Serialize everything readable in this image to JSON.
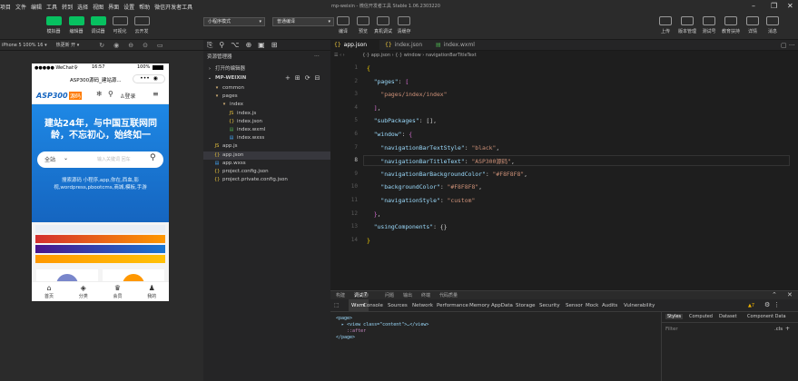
{
  "menu": [
    "项目",
    "文件",
    "编辑",
    "工具",
    "转到",
    "选择",
    "视图",
    "界面",
    "设置",
    "帮助",
    "微信开发者工具"
  ],
  "window_title": "mp-weixin - 微信开发者工具 Stable 1.06.2303220",
  "toolbar": {
    "left": [
      {
        "label": "模拟器",
        "icon": "phone-icon",
        "active": true
      },
      {
        "label": "编辑器",
        "icon": "code-icon",
        "active": true
      },
      {
        "label": "调试器",
        "icon": "debug-icon",
        "active": true
      },
      {
        "label": "可视化",
        "icon": "visual-icon",
        "active": false
      },
      {
        "label": "云开发",
        "icon": "cloud-icon",
        "active": false
      }
    ],
    "mode_select": "小程序模式",
    "compile_select": "普通编译",
    "center": [
      {
        "label": "编译",
        "icon": "refresh-icon"
      },
      {
        "label": "预览",
        "icon": "eye-icon"
      },
      {
        "label": "真机调试",
        "icon": "device-icon"
      },
      {
        "label": "清缓存",
        "icon": "clear-icon"
      }
    ],
    "right": [
      {
        "label": "上传",
        "icon": "upload-icon"
      },
      {
        "label": "版本管理",
        "icon": "branch-icon"
      },
      {
        "label": "测试号",
        "icon": "test-icon"
      },
      {
        "label": "教育扶持",
        "icon": "edu-icon"
      },
      {
        "label": "详情",
        "icon": "detail-icon"
      },
      {
        "label": "消息",
        "icon": "bell-icon"
      }
    ]
  },
  "simulator": {
    "device": "iPhone 5 100% 16 ▾",
    "network": "热更新 开 ▾",
    "status_left": "●●●●● WeChat令",
    "status_time": "16:57",
    "status_right": "100%",
    "nav_title": "ASP300源码_建站源...",
    "logo_text": "ASP300",
    "logo_badge": "源码",
    "login": "登录",
    "hero_title": "建站24年，与中国互联网同龄，不忘初心，始终如一",
    "search_scope": "全站",
    "search_placeholder": "输入关键词 回车",
    "hero_sub": "搜索源码 小程序,app,你在,西血,影视,wordpress,pbootcms,商城,模板,手游",
    "tabs": [
      {
        "label": "首页",
        "icon": "home-icon"
      },
      {
        "label": "分类",
        "icon": "layers-icon"
      },
      {
        "label": "会员",
        "icon": "crown-icon"
      },
      {
        "label": "我的",
        "icon": "user-icon"
      }
    ]
  },
  "explorer": {
    "title": "资源管理器",
    "open_editors": "打开的编辑器",
    "root": "MP-WEIXIN",
    "items": [
      {
        "name": "common",
        "type": "folder",
        "depth": 1
      },
      {
        "name": "pages",
        "type": "folder",
        "depth": 1
      },
      {
        "name": "index",
        "type": "folder",
        "depth": 2
      },
      {
        "name": "index.js",
        "type": "js",
        "depth": 3
      },
      {
        "name": "index.json",
        "type": "json",
        "depth": 3
      },
      {
        "name": "index.wxml",
        "type": "wxml",
        "depth": 3
      },
      {
        "name": "index.wxss",
        "type": "wxss",
        "depth": 3
      },
      {
        "name": "app.js",
        "type": "js",
        "depth": 1
      },
      {
        "name": "app.json",
        "type": "json",
        "depth": 1,
        "selected": true
      },
      {
        "name": "app.wxss",
        "type": "wxss",
        "depth": 1
      },
      {
        "name": "project.config.json",
        "type": "json",
        "depth": 1
      },
      {
        "name": "project.private.config.json",
        "type": "json",
        "depth": 1
      }
    ]
  },
  "editor": {
    "tabs": [
      {
        "label": "app.json",
        "active": true
      },
      {
        "label": "index.json",
        "active": false
      },
      {
        "label": "index.wxml",
        "active": false
      }
    ],
    "breadcrumb": "{·} app.json  ›  {·} window  ›  navigationBarTitleText",
    "current_line": 8,
    "lines": [
      [
        [
          "b",
          "{"
        ]
      ],
      [
        [
          "k",
          "  \"pages\""
        ],
        [
          "p",
          ": "
        ],
        [
          "b2",
          "["
        ]
      ],
      [
        [
          "s",
          "    \"pages/index/index\""
        ]
      ],
      [
        [
          "b2",
          "  ]"
        ],
        [
          "p",
          ","
        ]
      ],
      [
        [
          "k",
          "  \"subPackages\""
        ],
        [
          "p",
          ": [],"
        ]
      ],
      [
        [
          "k",
          "  \"window\""
        ],
        [
          "p",
          ": "
        ],
        [
          "b2",
          "{"
        ]
      ],
      [
        [
          "k",
          "    \"navigationBarTextStyle\""
        ],
        [
          "p",
          ": "
        ],
        [
          "s",
          "\"black\""
        ],
        [
          "p",
          ","
        ]
      ],
      [
        [
          "k",
          "    \"navigationBarTitleText\""
        ],
        [
          "p",
          ": "
        ],
        [
          "s",
          "\"ASP300源码\""
        ],
        [
          "p",
          ","
        ]
      ],
      [
        [
          "k",
          "    \"navigationBarBackgroundColor\""
        ],
        [
          "p",
          ": "
        ],
        [
          "s",
          "\"#F8F8F8\""
        ],
        [
          "p",
          ","
        ]
      ],
      [
        [
          "k",
          "    \"backgroundColor\""
        ],
        [
          "p",
          ": "
        ],
        [
          "s",
          "\"#F8F8F8\""
        ],
        [
          "p",
          ","
        ]
      ],
      [
        [
          "k",
          "    \"navigationStyle\""
        ],
        [
          "p",
          ": "
        ],
        [
          "s",
          "\"custom\""
        ]
      ],
      [
        [
          "b2",
          "  }"
        ],
        [
          "p",
          ","
        ]
      ],
      [
        [
          "k",
          "  \"usingComponents\""
        ],
        [
          "p",
          ": {}"
        ]
      ],
      [
        [
          "b",
          "}"
        ]
      ]
    ]
  },
  "devtools": {
    "top_tabs": [
      "构建",
      "调试器",
      "问题",
      "输出",
      "终端",
      "代码质量"
    ],
    "debugger_count": "7",
    "tabs": [
      "Wxml",
      "Console",
      "Sources",
      "Network",
      "Performance",
      "Memory",
      "AppData",
      "Storage",
      "Security",
      "Sensor",
      "Mock",
      "Audits",
      "Vulnerability"
    ],
    "warn_count": "7",
    "dom": [
      "<page>",
      "  ▸ <view class=\"content\">…</view>",
      "    ::after",
      "</page>"
    ],
    "side_tabs": [
      "Styles",
      "Computed",
      "Dataset",
      "Component Data"
    ],
    "filter_placeholder": "Filter",
    "cls": ".cls"
  }
}
